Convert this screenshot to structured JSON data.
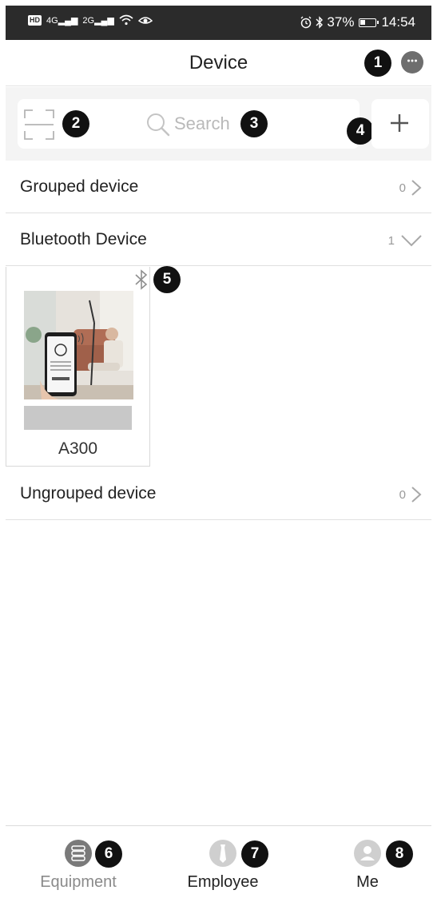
{
  "status_bar": {
    "left_hd": "HD",
    "left_signal_1": "4G",
    "left_signal_2": "2G",
    "battery_percent": "37%",
    "battery_level": 0.37,
    "time": "14:54"
  },
  "header": {
    "title": "Device"
  },
  "search": {
    "placeholder": "Search"
  },
  "groups": [
    {
      "label": "Grouped device",
      "count": "0"
    },
    {
      "label": "Bluetooth Device",
      "count": "1"
    },
    {
      "label": "Ungrouped device",
      "count": "0"
    }
  ],
  "device_card": {
    "name": "A300"
  },
  "bottom_nav": [
    {
      "label": "Equipment",
      "color": "#8a8a8a"
    },
    {
      "label": "Employee",
      "color": "#222222"
    },
    {
      "label": "Me",
      "color": "#222222"
    }
  ],
  "badges": [
    "1",
    "2",
    "3",
    "4",
    "5",
    "6",
    "7",
    "8"
  ],
  "colors": {
    "status_bar_bg": "#2b2b2b",
    "search_zone_bg": "#f4f4f4",
    "badge_bg": "#111111",
    "icon_gray": "#9a9a9a"
  }
}
